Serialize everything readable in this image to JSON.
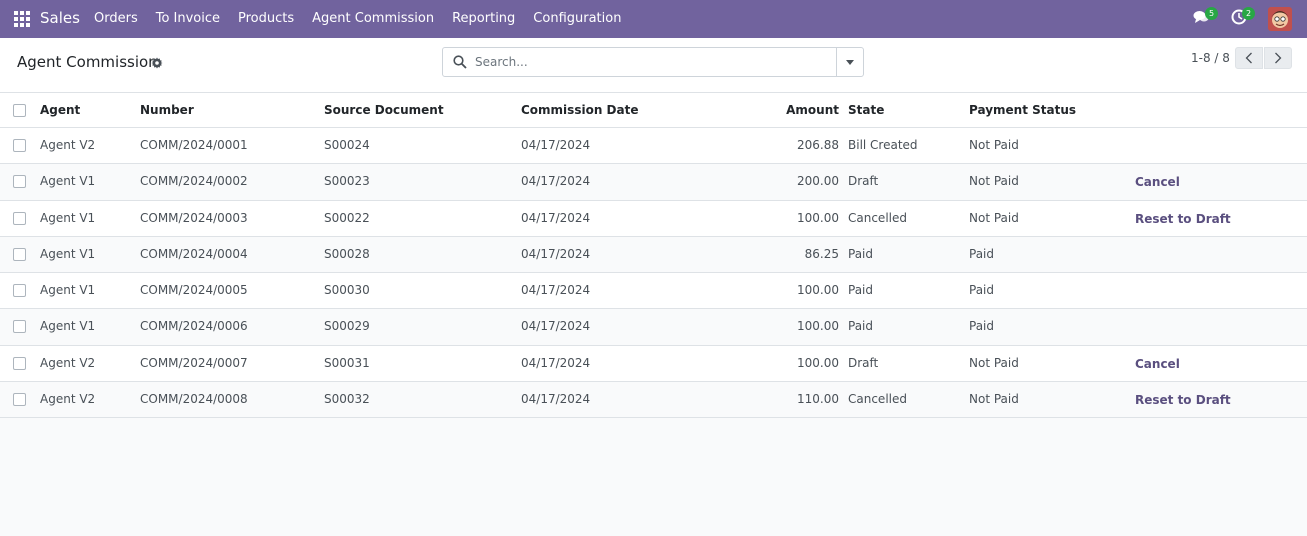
{
  "navbar": {
    "brand": "Sales",
    "menu": [
      "Orders",
      "To Invoice",
      "Products",
      "Agent Commission",
      "Reporting",
      "Configuration"
    ],
    "messages_count": "5",
    "activities_count": "2",
    "color": "#71639e"
  },
  "control": {
    "title": "Agent Commission",
    "search_placeholder": "Search...",
    "pager": "1-8 / 8"
  },
  "table": {
    "headers": {
      "agent": "Agent",
      "number": "Number",
      "source": "Source Document",
      "date": "Commission Date",
      "amount": "Amount",
      "state": "State",
      "payment": "Payment Status"
    },
    "rows": [
      {
        "agent": "Agent V2",
        "number": "COMM/2024/0001",
        "source": "S00024",
        "date": "04/17/2024",
        "amount": "206.88",
        "state": "Bill Created",
        "payment": "Not Paid",
        "action": ""
      },
      {
        "agent": "Agent V1",
        "number": "COMM/2024/0002",
        "source": "S00023",
        "date": "04/17/2024",
        "amount": "200.00",
        "state": "Draft",
        "payment": "Not Paid",
        "action": "Cancel"
      },
      {
        "agent": "Agent V1",
        "number": "COMM/2024/0003",
        "source": "S00022",
        "date": "04/17/2024",
        "amount": "100.00",
        "state": "Cancelled",
        "payment": "Not Paid",
        "action": "Reset to Draft"
      },
      {
        "agent": "Agent V1",
        "number": "COMM/2024/0004",
        "source": "S00028",
        "date": "04/17/2024",
        "amount": "86.25",
        "state": "Paid",
        "payment": "Paid",
        "action": ""
      },
      {
        "agent": "Agent V1",
        "number": "COMM/2024/0005",
        "source": "S00030",
        "date": "04/17/2024",
        "amount": "100.00",
        "state": "Paid",
        "payment": "Paid",
        "action": ""
      },
      {
        "agent": "Agent V1",
        "number": "COMM/2024/0006",
        "source": "S00029",
        "date": "04/17/2024",
        "amount": "100.00",
        "state": "Paid",
        "payment": "Paid",
        "action": ""
      },
      {
        "agent": "Agent V2",
        "number": "COMM/2024/0007",
        "source": "S00031",
        "date": "04/17/2024",
        "amount": "100.00",
        "state": "Draft",
        "payment": "Not Paid",
        "action": "Cancel"
      },
      {
        "agent": "Agent V2",
        "number": "COMM/2024/0008",
        "source": "S00032",
        "date": "04/17/2024",
        "amount": "110.00",
        "state": "Cancelled",
        "payment": "Not Paid",
        "action": "Reset to Draft"
      }
    ]
  }
}
